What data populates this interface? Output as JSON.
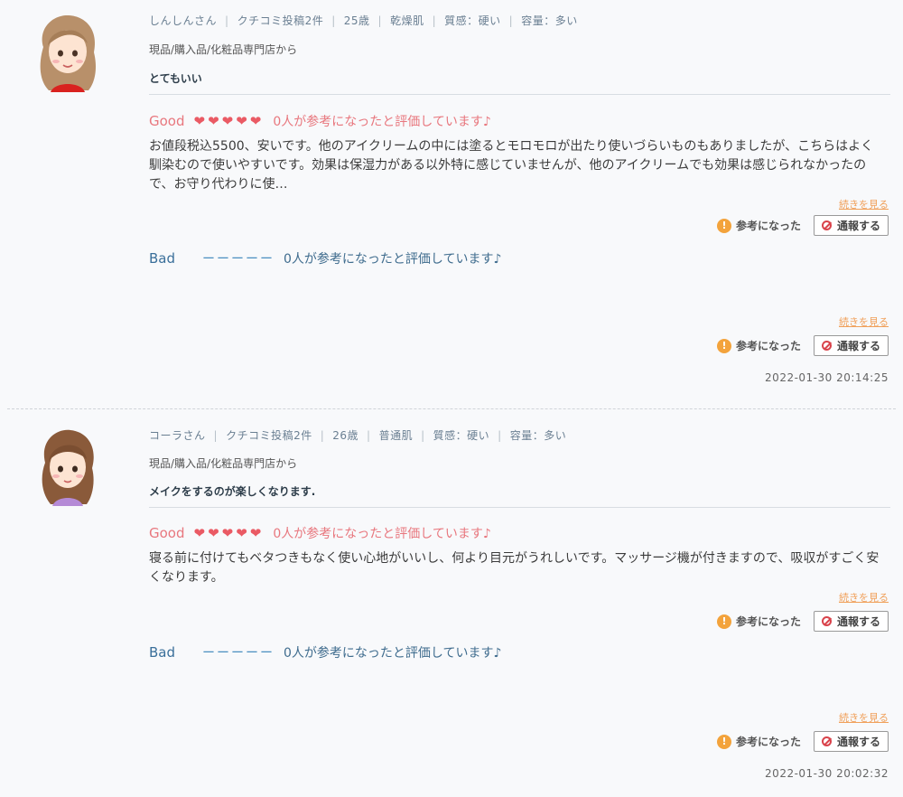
{
  "reviews": [
    {
      "user": "しんしんさん",
      "post_count": "クチコミ投稿2件",
      "age": "25歳",
      "skin_type": "乾燥肌",
      "texture": "質感：硬い",
      "amount": "容量：多い",
      "source": "現品/購入品/化粧品専門店から",
      "headline": "とてもいい",
      "good_label": "Good",
      "hearts": "❤❤❤❤❤",
      "good_helpful": "0人が参考になったと評価しています♪",
      "good_text": "お値段税込5500、安いです。他のアイクリームの中には塗るとモロモロが出たり使いづらいものもありましたが、こちらはよく馴染むので使いやすいです。効果は保湿力がある以外特に感じていませんが、他のアイクリームでも効果は感じられなかったので、お守り代わりに使…",
      "more_link": "続きを見る",
      "helpful_label": "参考になった",
      "report_label": "通報する",
      "bad_label": "Bad",
      "bad_dashes": "ーーーーー",
      "bad_helpful": "0人が参考になったと評価しています♪",
      "timestamp": "2022-01-30 20:14:25"
    },
    {
      "user": "コーラさん",
      "post_count": "クチコミ投稿2件",
      "age": "26歳",
      "skin_type": "普通肌",
      "texture": "質感：硬い",
      "amount": "容量：多い",
      "source": "現品/購入品/化粧品専門店から",
      "headline": "メイクをするのが楽しくなります.",
      "good_label": "Good",
      "hearts": "❤❤❤❤❤",
      "good_helpful": "0人が参考になったと評価しています♪",
      "good_text": "寝る前に付けてもベタつきもなく使い心地がいいし、何より目元がうれしいです。マッサージ機が付きますので、吸収がすごく安くなります。",
      "more_link": "続きを見る",
      "helpful_label": "参考になった",
      "report_label": "通報する",
      "bad_label": "Bad",
      "bad_dashes": "ーーーーー",
      "bad_helpful": "0人が参考になったと評価しています♪",
      "timestamp": "2022-01-30 20:02:32"
    }
  ],
  "colors": {
    "good": "#e8777e",
    "heart": "#ea5a64",
    "bad": "#3a6f9a",
    "link": "#f0a05a",
    "bulb": "#f3a33c"
  },
  "icons": [
    "heart-icon",
    "lightbulb-icon",
    "prohibit-icon",
    "avatar-icon"
  ]
}
